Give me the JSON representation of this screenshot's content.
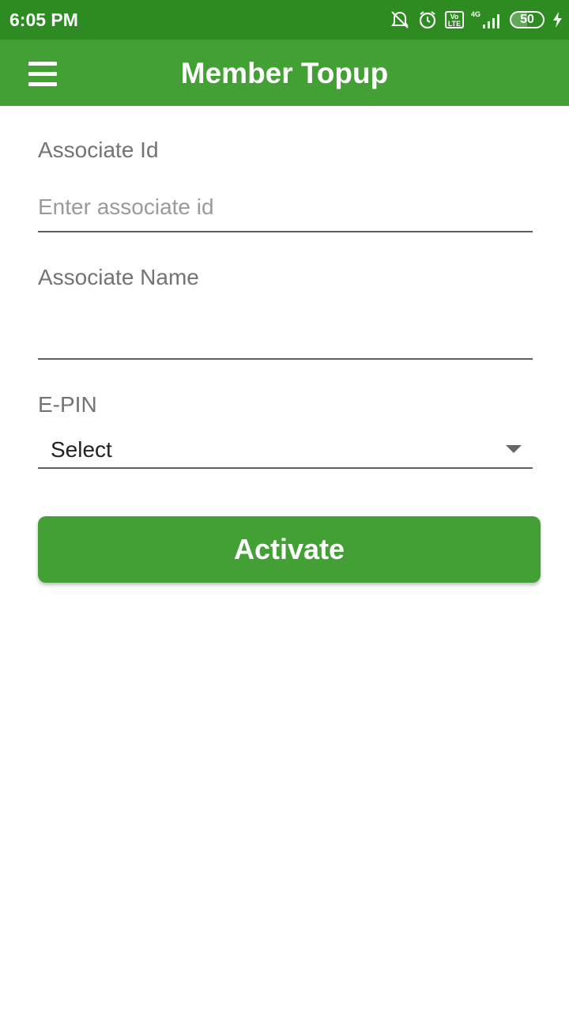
{
  "status_bar": {
    "time": "6:05 PM",
    "network_label": "4G",
    "volte_label": "Vo LTE",
    "battery_level": "50",
    "icons": [
      "alarm-off-icon",
      "alarm-icon",
      "volte-icon",
      "signal-icon",
      "battery-icon",
      "charging-icon"
    ]
  },
  "app_bar": {
    "title": "Member Topup",
    "menu_icon": "hamburger-menu-icon"
  },
  "form": {
    "associate_id": {
      "label": "Associate Id",
      "placeholder": "Enter associate id",
      "value": ""
    },
    "associate_name": {
      "label": "Associate Name",
      "value": ""
    },
    "epin": {
      "label": "E-PIN",
      "selected": "Select"
    },
    "submit_label": "Activate"
  },
  "colors": {
    "status_bar": "#2e8b22",
    "primary": "#43a035",
    "label": "#737373"
  }
}
